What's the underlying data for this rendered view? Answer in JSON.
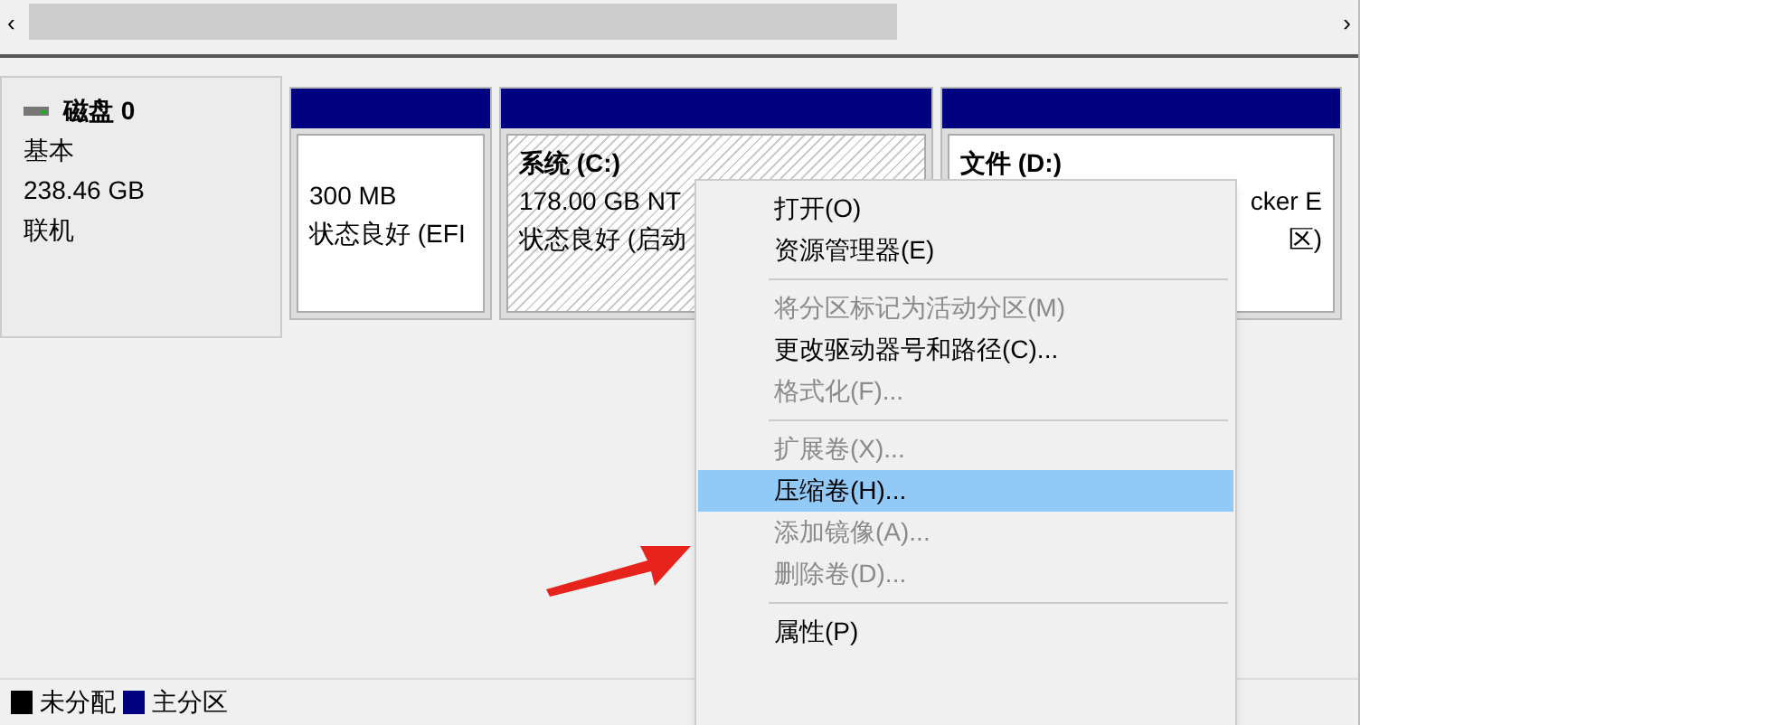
{
  "disk": {
    "name": "磁盘 0",
    "type": "基本",
    "size": "238.46 GB",
    "status": "联机"
  },
  "scrollbar": {
    "left": "‹",
    "right": "›"
  },
  "partitions": [
    {
      "lines": [
        "300 MB",
        "状态良好 (EFI"
      ],
      "hatched": false
    },
    {
      "title": "系统 (C:)",
      "lines": [
        "178.00 GB NT",
        "状态良好 (启动"
      ],
      "hatched": true
    },
    {
      "title": "文件 (D:)",
      "lines": [
        "cker E",
        "区)"
      ],
      "hatched": false
    }
  ],
  "legend": [
    {
      "label": "未分配",
      "color": "#000000"
    },
    {
      "label": "主分区",
      "color": "#000080"
    }
  ],
  "context_menu": [
    {
      "kind": "item",
      "label": "打开(O)",
      "disabled": false,
      "selected": false
    },
    {
      "kind": "item",
      "label": "资源管理器(E)",
      "disabled": false,
      "selected": false
    },
    {
      "kind": "separator"
    },
    {
      "kind": "item",
      "label": "将分区标记为活动分区(M)",
      "disabled": true,
      "selected": false
    },
    {
      "kind": "item",
      "label": "更改驱动器号和路径(C)...",
      "disabled": false,
      "selected": false
    },
    {
      "kind": "item",
      "label": "格式化(F)...",
      "disabled": true,
      "selected": false
    },
    {
      "kind": "separator"
    },
    {
      "kind": "item",
      "label": "扩展卷(X)...",
      "disabled": true,
      "selected": false
    },
    {
      "kind": "item",
      "label": "压缩卷(H)...",
      "disabled": false,
      "selected": true
    },
    {
      "kind": "item",
      "label": "添加镜像(A)...",
      "disabled": true,
      "selected": false
    },
    {
      "kind": "item",
      "label": "删除卷(D)...",
      "disabled": true,
      "selected": false
    },
    {
      "kind": "separator"
    },
    {
      "kind": "item",
      "label": "属性(P)",
      "disabled": false,
      "selected": false
    }
  ]
}
